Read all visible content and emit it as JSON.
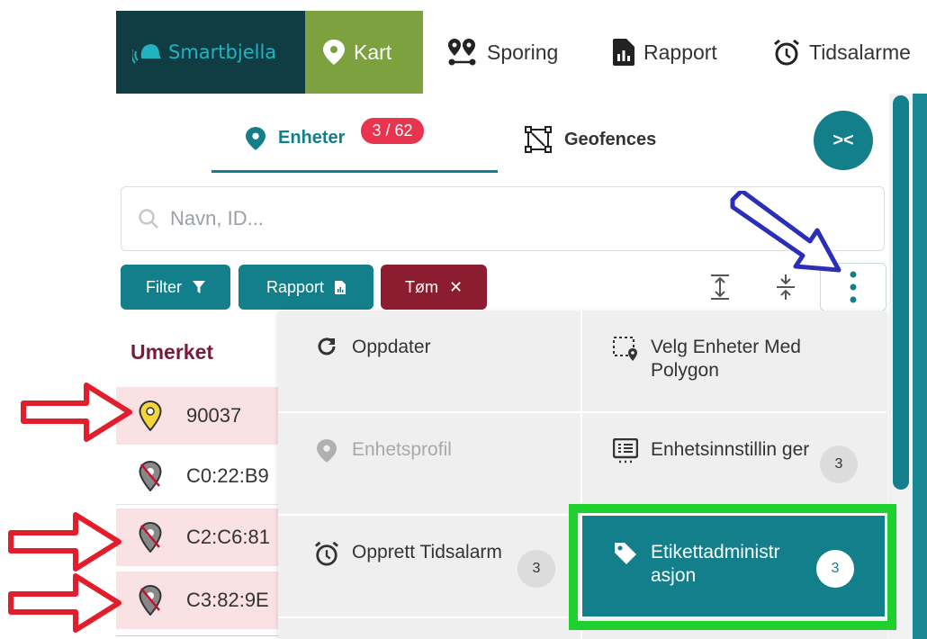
{
  "app": {
    "brand": "Smartbjella",
    "brand_color": "#0f3d43",
    "accent": "#137f8a",
    "kart_color": "#7ea140"
  },
  "nav": {
    "items": [
      {
        "label": "Kart",
        "icon": "map-pin-icon",
        "active": true
      },
      {
        "label": "Sporing",
        "icon": "route-icon"
      },
      {
        "label": "Rapport",
        "icon": "report-icon"
      },
      {
        "label": "Tidsalarme",
        "icon": "alarm-clock-icon"
      }
    ]
  },
  "tabs": {
    "enheter": {
      "label": "Enheter",
      "badge": "3 / 62",
      "active": true
    },
    "geofences": {
      "label": "Geofences"
    }
  },
  "search": {
    "placeholder": "Navn, ID..."
  },
  "filters": {
    "filter_label": "Filter",
    "rapport_label": "Rapport",
    "tom_label": "Tøm"
  },
  "list": {
    "group_title": "Umerket",
    "rows": [
      {
        "label": "90037",
        "selected": true,
        "pin": "yellow"
      },
      {
        "label": "C0:22:B9",
        "selected": false,
        "pin": "gray-crossed"
      },
      {
        "label": "C2:C6:81",
        "selected": true,
        "pin": "gray-crossed"
      },
      {
        "label": "C3:82:9E",
        "selected": true,
        "pin": "gray-crossed"
      }
    ]
  },
  "menu": {
    "oppdater": "Oppdater",
    "polygon": "Velg Enheter Med Polygon",
    "enhetsprofil": "Enhetsprofil",
    "enhetsinnstillinger": "Enhetsinnstillin ger",
    "enhetsinnstillinger_badge": "3",
    "opprett_tidsalarm": "Opprett Tidsalarm",
    "opprett_tidsalarm_badge": "3",
    "etikettadministrasjon": "Etikettadministr asjon",
    "etikettadministrasjon_badge": "3"
  }
}
